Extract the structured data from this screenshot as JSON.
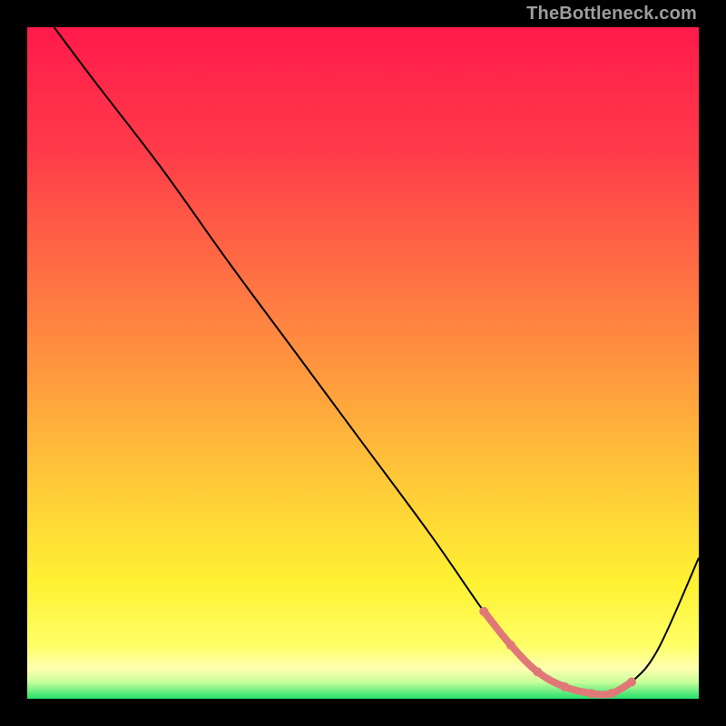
{
  "watermark": "TheBottleneck.com",
  "chart_data": {
    "type": "line",
    "title": "",
    "xlabel": "",
    "ylabel": "",
    "xlim": [
      0,
      100
    ],
    "ylim": [
      0,
      100
    ],
    "grid": false,
    "legend": false,
    "series": [
      {
        "name": "bottleneck-curve",
        "color": "#000000",
        "x": [
          4,
          10,
          20,
          30,
          40,
          50,
          60,
          68,
          72,
          76,
          80,
          84,
          87,
          90,
          94,
          100
        ],
        "values": [
          100,
          92,
          79,
          65,
          51.5,
          38,
          24.5,
          13,
          8,
          4,
          1.8,
          0.8,
          0.8,
          2.5,
          7.5,
          21
        ]
      }
    ],
    "highlight_band": {
      "name": "optimal-range",
      "color": "#e07878",
      "x": [
        68,
        72,
        76,
        80,
        84,
        87,
        90
      ],
      "values": [
        13,
        8,
        4,
        1.8,
        0.8,
        0.8,
        2.5
      ]
    },
    "background_gradient": {
      "stops": [
        {
          "offset": 0.0,
          "color": "#ff1a4b"
        },
        {
          "offset": 0.18,
          "color": "#ff3a4a"
        },
        {
          "offset": 0.35,
          "color": "#ff6a44"
        },
        {
          "offset": 0.52,
          "color": "#ff9a3e"
        },
        {
          "offset": 0.68,
          "color": "#ffca38"
        },
        {
          "offset": 0.83,
          "color": "#fff233"
        },
        {
          "offset": 0.92,
          "color": "#ffff66"
        },
        {
          "offset": 0.955,
          "color": "#ffffb0"
        },
        {
          "offset": 0.975,
          "color": "#c8ff9a"
        },
        {
          "offset": 1.0,
          "color": "#22e06b"
        }
      ]
    }
  }
}
